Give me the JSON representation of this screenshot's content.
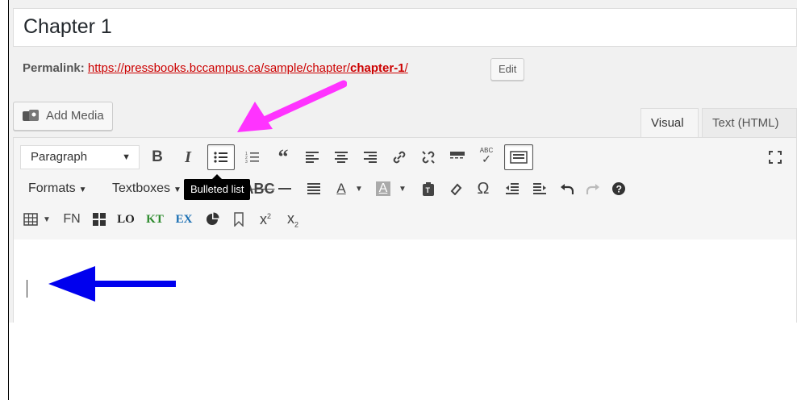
{
  "title_field": {
    "value": "Chapter 1"
  },
  "permalink": {
    "label": "Permalink:",
    "url_prefix": "https://pressbooks.bccampus.ca/sample/chapter/",
    "url_slug": "chapter-1",
    "url_suffix": "/",
    "edit_label": "Edit"
  },
  "media": {
    "add_label": "Add Media",
    "icon": "add-media-icon"
  },
  "tabs": [
    {
      "label": "Visual",
      "active": true
    },
    {
      "label": "Text (HTML)",
      "active": false
    }
  ],
  "toolbar": {
    "format_select": "Paragraph",
    "formats_menu": "Formats",
    "textboxes_menu": "Textboxes",
    "fn_label": "FN",
    "lo_label": "LO",
    "kt_label": "KT",
    "ex_label": "EX",
    "abc_label": "ABC",
    "tooltip": "Bulleted list"
  },
  "colors": {
    "permalink": "#cc0000",
    "pink_arrow": "#ff33ff",
    "blue_arrow": "#0000ee",
    "kt": "#2e8b2e",
    "ex": "#1a6fb3"
  }
}
